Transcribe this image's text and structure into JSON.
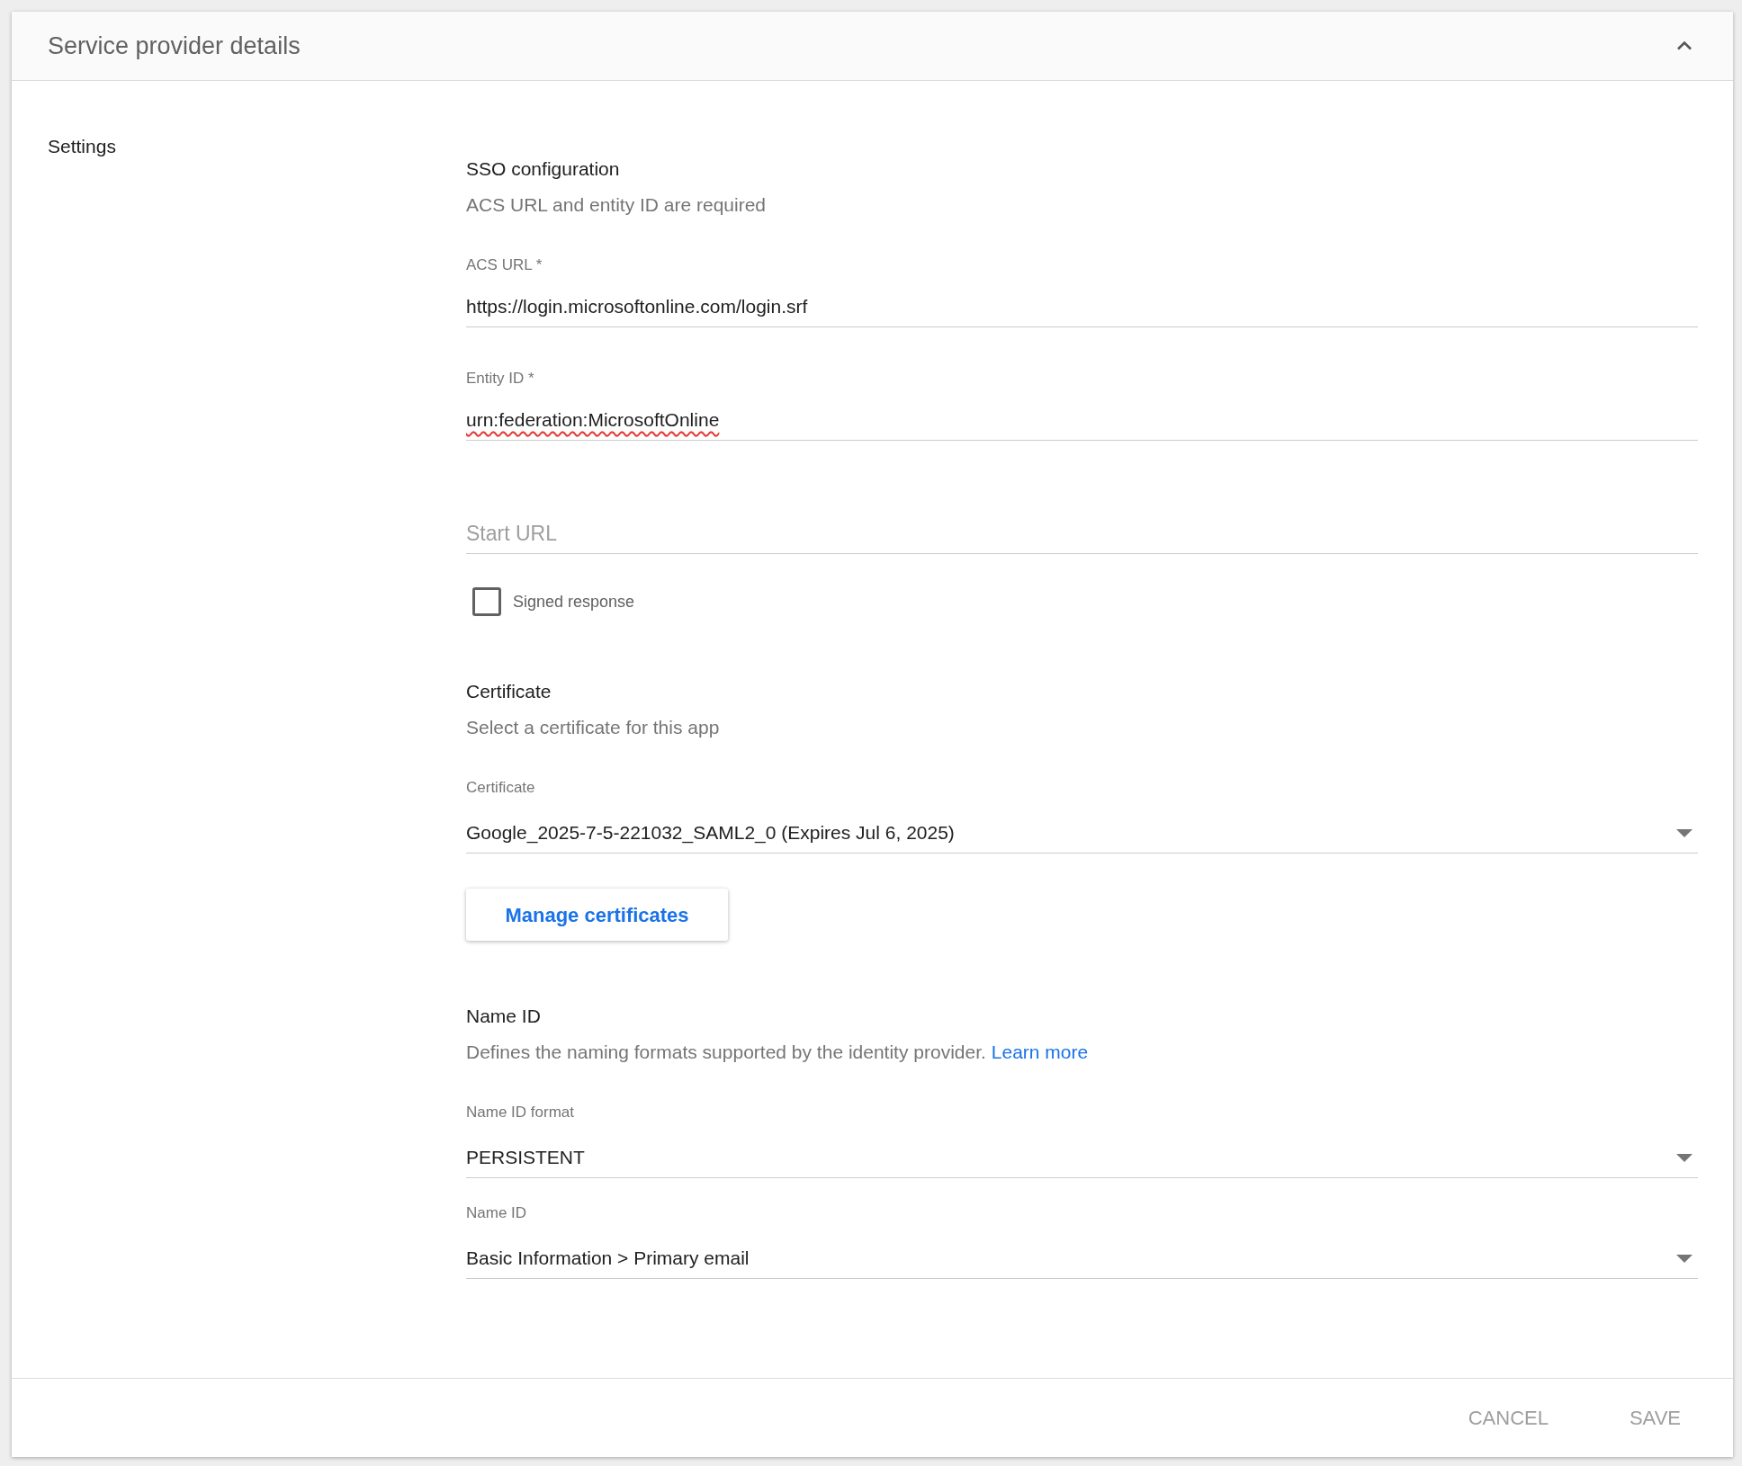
{
  "panel": {
    "title": "Service provider details",
    "expanded": true
  },
  "settings_label": "Settings",
  "sections": [
    {
      "heading": "SSO configuration",
      "description": "ACS URL and entity ID are required",
      "items": [
        {
          "kind": "text",
          "label": "ACS URL *",
          "value": "https://login.microsoftonline.com/login.srf",
          "misspelled": false
        },
        {
          "kind": "text",
          "label": "Entity ID *",
          "value": "urn:federation:MicrosoftOnline",
          "misspelled": true
        },
        {
          "kind": "text",
          "placeholder": "Start URL"
        },
        {
          "kind": "checkbox",
          "label": "Signed response",
          "checked": false
        }
      ]
    },
    {
      "heading": "Certificate",
      "description": "Select a certificate for this app",
      "items": [
        {
          "kind": "select",
          "label": "Certificate",
          "value": "Google_2025-7-5-221032_SAML2_0 (Expires Jul 6, 2025)"
        },
        {
          "kind": "button",
          "label": "Manage certificates"
        }
      ]
    },
    {
      "heading": "Name ID",
      "description": "Defines the naming formats supported by the identity provider.",
      "link": "Learn more",
      "items": [
        {
          "kind": "select",
          "label": "Name ID format",
          "value": "PERSISTENT"
        },
        {
          "kind": "select",
          "label": "Name ID",
          "value": "Basic Information > Primary email"
        }
      ]
    }
  ],
  "footer_buttons": [
    {
      "label": "CANCEL",
      "disabled": true
    },
    {
      "label": "SAVE",
      "disabled": true
    }
  ]
}
